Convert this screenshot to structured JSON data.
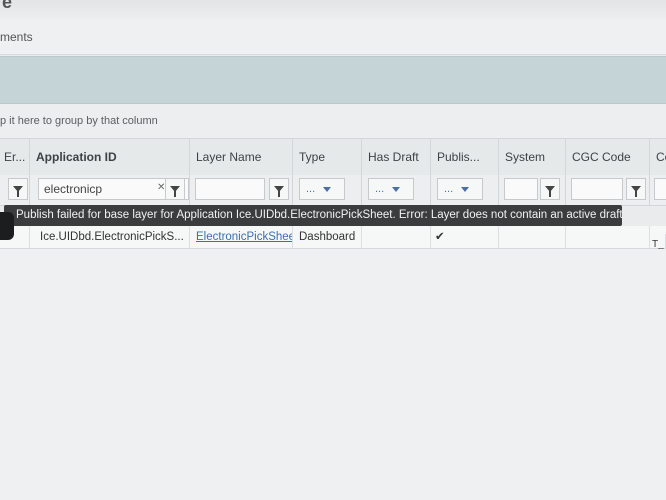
{
  "page": {
    "title_fragment": "e",
    "breadcrumb": "ments"
  },
  "grid": {
    "group_hint": "p it here to group by that column",
    "columns": [
      {
        "label": "Er..."
      },
      {
        "label": "Application ID"
      },
      {
        "label": "Layer Name"
      },
      {
        "label": "Type"
      },
      {
        "label": "Has Draft"
      },
      {
        "label": "Publis..."
      },
      {
        "label": "System"
      },
      {
        "label": "CGC Code"
      },
      {
        "label": "Co"
      }
    ],
    "filters": {
      "application_id_value": "electronicp",
      "dropdown_label": "..."
    },
    "error_tooltip": "Publish failed for base layer for Application Ice.UIDbd.ElectronicPickSheet. Error: Layer does not contain an active draft.",
    "rows": [
      {
        "application_id": "Ice.UIDbd.ElectronicPickS...",
        "layer_name": "ElectronicPickShee",
        "type": "Dashboard",
        "published": "✔",
        "extra": "T_"
      }
    ]
  },
  "icons": {
    "filter": "funnel-icon",
    "clear_filter": "clear-filter-icon",
    "dropdown": "chevron-down-icon",
    "error": "error-indicator-icon"
  }
}
